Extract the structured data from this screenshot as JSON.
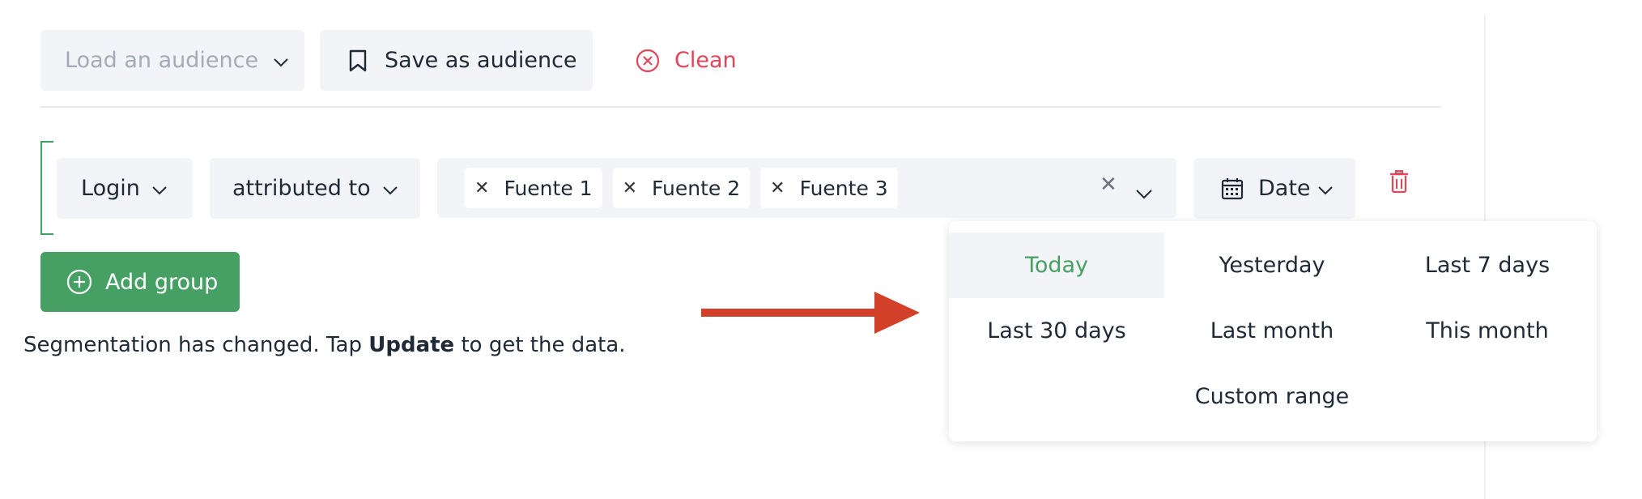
{
  "toolbar": {
    "load_audience_label": "Load an audience",
    "save_audience_label": "Save as audience",
    "clean_label": "Clean"
  },
  "segment": {
    "event_label": "Login",
    "relation_label": "attributed to",
    "sources": [
      {
        "label": "Fuente 1"
      },
      {
        "label": "Fuente 2"
      },
      {
        "label": "Fuente 3"
      }
    ],
    "date_label": "Date"
  },
  "add_group_label": "Add group",
  "status": {
    "before": "Segmentation has changed. Tap ",
    "bold": "Update",
    "after": " to get the data."
  },
  "date_options": [
    {
      "label": "Today",
      "selected": true
    },
    {
      "label": "Yesterday"
    },
    {
      "label": "Last 7 days"
    },
    {
      "label": "Last 30 days"
    },
    {
      "label": "Last month"
    },
    {
      "label": "This month"
    },
    {
      "label": "Custom range"
    }
  ],
  "colors": {
    "accent_green": "#46a063",
    "danger_red": "#e0465a",
    "arrow_red": "#d2402a"
  },
  "icons": {
    "save": "bookmark-icon",
    "clean": "circle-x-icon",
    "date": "calendar-icon",
    "delete": "trash-icon",
    "add": "circle-plus-icon"
  }
}
